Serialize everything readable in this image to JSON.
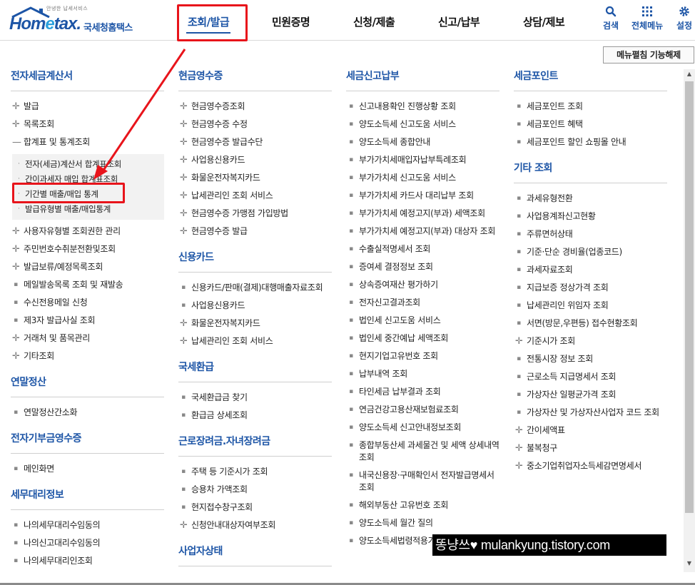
{
  "logo": {
    "tagline": "안녕한 납세서비스",
    "word_before": "Hom",
    "word_e": "e",
    "word_after": "tax.",
    "kr": "국세청홈택스"
  },
  "gnb": [
    {
      "label": "조회/발급",
      "active": true
    },
    {
      "label": "민원증명",
      "active": false
    },
    {
      "label": "신청/제출",
      "active": false
    },
    {
      "label": "신고/납부",
      "active": false
    },
    {
      "label": "상담/제보",
      "active": false
    }
  ],
  "util": {
    "search": "검색",
    "all_menu": "전체메뉴",
    "settings": "설정"
  },
  "collapse_button": "메뉴펼침 기능해제",
  "col1": {
    "sec1_title": "전자세금계산서",
    "sec1_items": [
      "발급",
      "목록조회",
      "합계표 및 통계조회"
    ],
    "sec1_sub": [
      "전자(세금)계산서 합계표조회",
      "간이과세자 매입 합계표조회",
      "기간별 매출/매입 통계",
      "발급유형별 매출/매입통계"
    ],
    "sec1_items2": [
      "사용자유형별 조회권한 관리",
      "주민번호수취분전환및조회",
      "발급보류/예정목록조회",
      "메일발송목록 조회 및 재발송",
      "수신전용메일 신청",
      "제3자 발급사실 조회",
      "거래처 및 품목관리",
      "기타조회"
    ],
    "sec2_title": "연말정산",
    "sec2_items": [
      "연말정산간소화"
    ],
    "sec3_title": "전자기부금영수증",
    "sec3_items": [
      "메인화면"
    ],
    "sec4_title": "세무대리정보",
    "sec4_items": [
      "나의세무대리수임동의",
      "나의신고대리수임동의",
      "나의세무대리인조회"
    ]
  },
  "col2": {
    "sec1_title": "현금영수증",
    "sec1_items": [
      "현금영수증조회",
      "현금영수증 수정",
      "현금영수증 발급수단",
      "사업용신용카드",
      "화물운전자복지카드",
      "납세관리인 조회 서비스",
      "현금영수증 가맹점 가입방법",
      "현금영수증 발급"
    ],
    "sec2_title": "신용카드",
    "sec2_items": [
      "신용카드/판매(결제)대행매출자료조회",
      "사업용신용카드",
      "화물운전자복지카드",
      "납세관리인 조회 서비스"
    ],
    "sec3_title": "국세환급",
    "sec3_items": [
      "국세환급금 찾기",
      "환급금 상세조회"
    ],
    "sec4_title": "근로장려금.자녀장려금",
    "sec4_items": [
      "주택 등 기준시가 조회",
      "승용차 가액조회",
      "현지접수창구조회",
      "신청안내대상자여부조회"
    ],
    "sec5_title": "사업자상태"
  },
  "col3": {
    "sec1_title": "세금신고납부",
    "sec1_items": [
      "신고내용확인 진행상황 조회",
      "양도소득세 신고도움 서비스",
      "양도소득세 종합안내",
      "부가가치세매입자납부특례조회",
      "부가가치세 신고도움 서비스",
      "부가가치세 카드사 대리납부 조회",
      "부가가치세 예정고지(부과) 세액조회",
      "부가가치세 예정고지(부과) 대상자 조회",
      "수출실적명세서 조회",
      "증여세 결정정보 조회",
      "상속증여재산 평가하기",
      "전자신고결과조회",
      "법인세 신고도움 서비스",
      "법인세 중간예납 세액조회",
      "현지기업고유번호 조회",
      "납부내역 조회",
      "타인세금 납부결과 조회",
      "연금건강고용산재보험료조회",
      "양도소득세 신고안내정보조회",
      "종합부동산세 과세물건 및 세액 상세내역 조회",
      "내국신용장·구매확인서 전자발급명세서 조회",
      "해외부동산 고유번호 조회",
      "양도소득세 월간 질의",
      "양도소득세법령적용가이드북"
    ]
  },
  "col4": {
    "sec1_title": "세금포인트",
    "sec1_items": [
      "세금포인트 조회",
      "세금포인트 혜택",
      "세금포인트 할인 쇼핑몰 안내"
    ],
    "sec2_title": "기타 조회",
    "sec2_items": [
      "과세유형전환",
      "사업용계좌신고현황",
      "주류면허상태",
      "기준·단순 경비율(업종코드)",
      "과세자료조회",
      "지급보증 정상가격 조회",
      "납세관리인 위임자 조회",
      "서면(방문,우편등) 접수현황조회",
      "기준시가 조회",
      "전통시장 정보 조회",
      "근로소득 지급명세서 조회",
      "가상자산 일평균가격 조회",
      "가상자산 및 가상자산사업자 코드 조회",
      "간이세액표",
      "불복청구",
      "중소기업취업자소득세감면명세서"
    ]
  },
  "watermark": "똥냥쓰♥ mulankyung.tistory.com",
  "colors": {
    "brand": "#1d55a6",
    "accent": "#2aa0dd",
    "annotation": "#e8141b"
  }
}
